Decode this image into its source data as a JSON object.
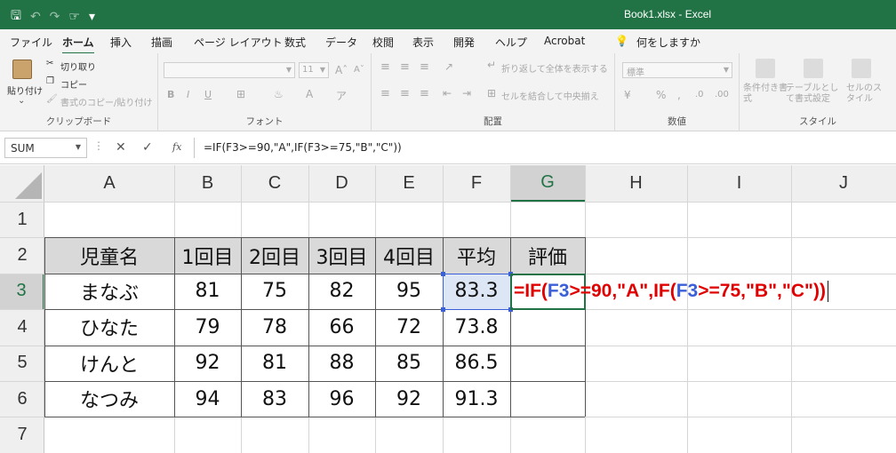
{
  "title_bar": {
    "window_title": "Book1.xlsx  -  Excel"
  },
  "menu": {
    "tabs": [
      "ファイル",
      "ホーム",
      "挿入",
      "描画",
      "ページ レイアウト",
      "数式",
      "データ",
      "校閲",
      "表示",
      "開発",
      "ヘルプ",
      "Acrobat"
    ],
    "search_label": "何をしますか"
  },
  "ribbon": {
    "clipboard": {
      "paste": "貼り付け",
      "cut": "切り取り",
      "copy": "コピー",
      "format_painter": "書式のコピー/貼り付け",
      "label": "クリップボード"
    },
    "font": {
      "size": "11",
      "label": "フォント"
    },
    "alignment": {
      "wrap": "折り返して全体を表示する",
      "merge": "セルを結合して中央揃え",
      "label": "配置"
    },
    "number": {
      "format": "標準",
      "label": "数値"
    },
    "styles": {
      "conditional": "条件付き書式",
      "table": "テーブルとして書式設定",
      "cell": "セルのスタイル",
      "label": "スタイル"
    }
  },
  "formula_bar": {
    "name_box": "SUM",
    "formula": "=IF(F3>=90,\"A\",IF(F3>=75,\"B\",\"C\"))",
    "fx": "fx"
  },
  "sheet": {
    "columns": [
      "A",
      "B",
      "C",
      "D",
      "E",
      "F",
      "G",
      "H",
      "I",
      "J"
    ],
    "rows": [
      "1",
      "2",
      "3",
      "4",
      "5",
      "6",
      "7"
    ],
    "headers": [
      "児童名",
      "1回目",
      "2回目",
      "3回目",
      "4回目",
      "平均",
      "評価"
    ],
    "data": [
      [
        "まなぶ",
        "81",
        "75",
        "82",
        "95",
        "83.3"
      ],
      [
        "ひなた",
        "79",
        "78",
        "66",
        "72",
        "73.8"
      ],
      [
        "けんと",
        "92",
        "81",
        "88",
        "85",
        "86.5"
      ],
      [
        "なつみ",
        "94",
        "83",
        "96",
        "92",
        "91.3"
      ]
    ],
    "editing_formula": {
      "p1": "=IF(",
      "ref1": "F3",
      "p2": ">=90,\"A\",IF(",
      "ref2": "F3",
      "p3": ">=75,\"B\",\"C\"))"
    },
    "colors": {
      "header_fill": "#d9d9d9",
      "selected_fill": "#dce6f4",
      "formula_red": "#e00000",
      "ref_blue": "#3b5fd6",
      "excel_green": "#217346"
    }
  }
}
